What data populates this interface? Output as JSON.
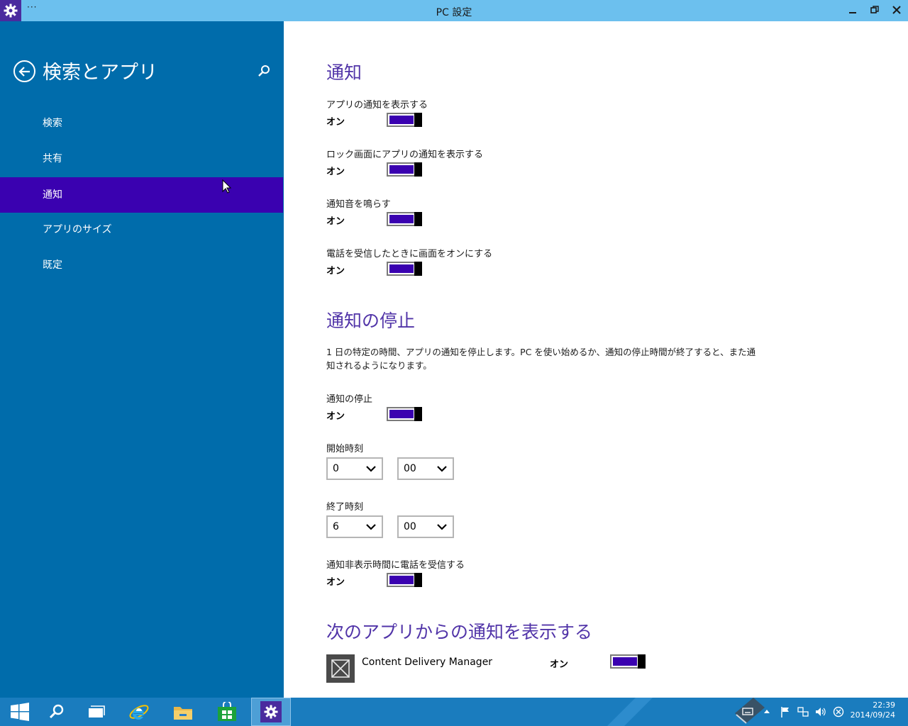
{
  "window": {
    "title": "PC 設定",
    "menu_dots": "···"
  },
  "sidebar": {
    "title": "検索とアプリ",
    "items": [
      {
        "label": "検索"
      },
      {
        "label": "共有"
      },
      {
        "label": "通知"
      },
      {
        "label": "アプリのサイズ"
      },
      {
        "label": "既定"
      }
    ],
    "active_item": "通知"
  },
  "main": {
    "notifications": {
      "title": "通知",
      "settings": [
        {
          "label": "アプリの通知を表示する",
          "state": "オン",
          "on": true
        },
        {
          "label": "ロック画面にアプリの通知を表示する",
          "state": "オン",
          "on": true
        },
        {
          "label": "通知音を鳴らす",
          "state": "オン",
          "on": true
        },
        {
          "label": "電話を受信したときに画面をオンにする",
          "state": "オン",
          "on": true
        }
      ]
    },
    "quiet_hours": {
      "title": "通知の停止",
      "description": "1 日の特定の時間、アプリの通知を停止します。PC を使い始めるか、通知の停止時間が終了すると、また通知されるようになります。",
      "toggle_label": "通知の停止",
      "toggle_state": "オン",
      "start_label": "開始時刻",
      "start_hour": "0",
      "start_minute": "00",
      "end_label": "終了時刻",
      "end_hour": "6",
      "end_minute": "00",
      "calls_label": "通知非表示時間に電話を受信する",
      "calls_state": "オン"
    },
    "app_notifications": {
      "title": "次のアプリからの通知を表示する",
      "apps": [
        {
          "name": "Content Delivery Manager",
          "state": "オン",
          "on": true
        }
      ]
    }
  },
  "taskbar": {
    "clock_time": "22:39",
    "clock_date": "2014/09/24"
  },
  "colors": {
    "titlebar": "#6cc0ee",
    "sidebar": "#006cab",
    "accent": "#3a01b0",
    "section_title": "#5134a8",
    "taskbar": "#1a7cbe"
  }
}
